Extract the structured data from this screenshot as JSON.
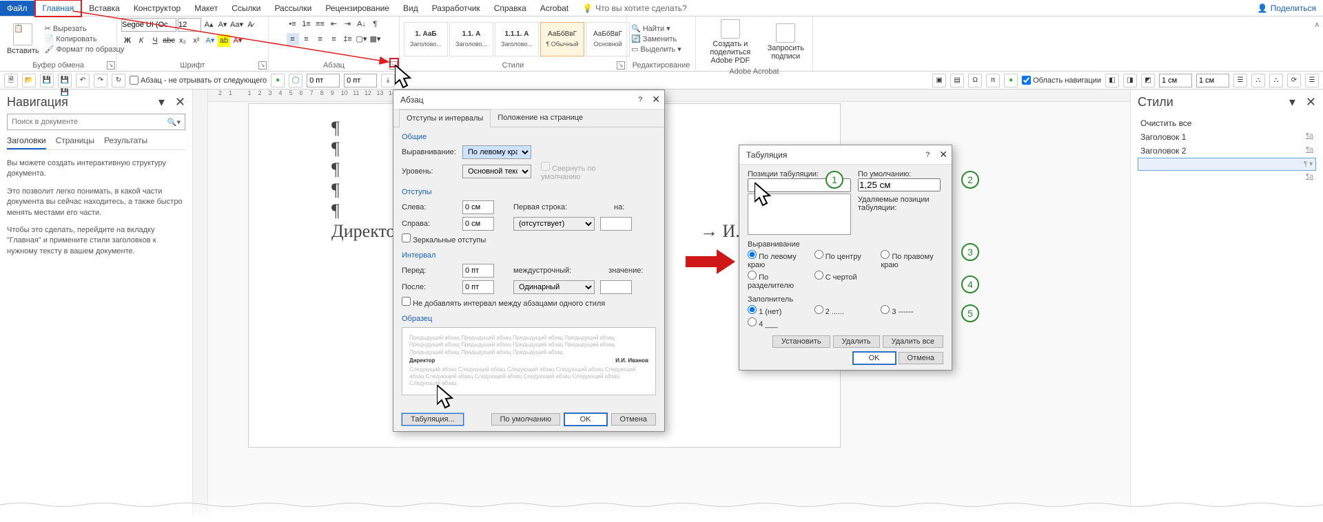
{
  "tabs": {
    "file": "Файл",
    "home": "Главная",
    "insert": "Вставка",
    "design": "Конструктор",
    "layout": "Макет",
    "references": "Ссылки",
    "mailings": "Рассылки",
    "review": "Рецензирование",
    "view": "Вид",
    "developer": "Разработчик",
    "help": "Справка",
    "acrobat": "Acrobat",
    "tellme": "Что вы хотите сделать?",
    "share": "Поделиться"
  },
  "ribbon": {
    "clipboard": {
      "paste": "Вставить",
      "cut": "Вырезать",
      "copy": "Копировать",
      "format_painter": "Формат по образцу",
      "title": "Буфер обмена"
    },
    "font": {
      "name": "Segoe UI (Ос",
      "size": "12",
      "title": "Шрифт"
    },
    "paragraph": {
      "title": "Абзац"
    },
    "styles": {
      "title": "Стили",
      "items": [
        {
          "preview": "1. АаБ",
          "name": "Заголово..."
        },
        {
          "preview": "1.1. А",
          "name": "Заголово..."
        },
        {
          "preview": "1.1.1. А",
          "name": "Заголово..."
        },
        {
          "preview": "АаБбВвГ",
          "name": "¶ Обычный"
        },
        {
          "preview": "АаБбВвГ",
          "name": "Основной"
        }
      ]
    },
    "editing": {
      "find": "Найти",
      "replace": "Заменить",
      "select": "Выделить",
      "title": "Редактирование"
    },
    "acrobat": {
      "create": "Создать и поделиться Adobe PDF",
      "request": "Запросить подписи",
      "title": "Adobe Acrobat"
    }
  },
  "qat": {
    "chk_label": "Абзац - не отрывать от следующего",
    "spinner1": "0 пт",
    "spinner2": "0 пт",
    "navpane": "Область навигации",
    "cm1": "1 см",
    "cm2": "1 см"
  },
  "nav": {
    "title": "Навигация",
    "search_placeholder": "Поиск в документе",
    "tabs": {
      "headings": "Заголовки",
      "pages": "Страницы",
      "results": "Результаты"
    },
    "p1": "Вы можете создать интерактивную структуру документа.",
    "p2": "Это позволит легко понимать, в какой части документа вы сейчас находитесь, а также быстро менять местами его части.",
    "p3": "Чтобы это сделать, перейдите на вкладку \"Главная\" и примените стили заголовков к нужному тексту в вашем документе."
  },
  "doc": {
    "director_line": "Директор →",
    "right_text": "→    И.И."
  },
  "styles_pane": {
    "title": "Стили",
    "clear": "Очистить все",
    "h1": "Заголовок 1",
    "h2": "Заголовок 2"
  },
  "dlg_para": {
    "tab1": "Отступы и интервалы",
    "tab2": "Положение на странице",
    "general": "Общие",
    "alignment_lbl": "Выравнивание:",
    "alignment_val": "По левому краю",
    "level_lbl": "Уровень:",
    "level_val": "Основной текст",
    "collapse": "Свернуть по умолчанию",
    "indents": "Отступы",
    "left_lbl": "Слева:",
    "left_val": "0 см",
    "right_lbl": "Справа:",
    "right_val": "0 см",
    "first_lbl": "Первая строка:",
    "first_val": "(отсутствует)",
    "on_lbl": "на:",
    "mirror": "Зеркальные отступы",
    "spacing": "Интервал",
    "before_lbl": "Перед:",
    "before_val": "0 пт",
    "after_lbl": "После:",
    "after_val": "0 пт",
    "line_lbl": "междустрочный:",
    "line_val": "Одинарный",
    "value_lbl": "значение:",
    "nosame": "Не добавлять интервал между абзацами одного стиля",
    "sample": "Образец",
    "sample_prev": "Предыдущий абзац Предыдущий абзац Предыдущий абзац Предыдущий абзац Предыдущий абзац Предыдущий абзац Предыдущий абзац Предыдущий абзац Предыдущий абзац Предыдущий абзац Предыдущий абзац",
    "sample_dir": "Директор",
    "sample_name": "И.И. Иванов",
    "sample_next": "Следующий абзац Следующий абзац Следующий абзац Следующий абзац Следующий абзац Следующий абзац Следующий абзац Следующий абзац Следующий абзац Следующий абзац",
    "tabs_btn": "Табуляция...",
    "default_btn": "По умолчанию",
    "ok": "OK",
    "cancel": "Отмена"
  },
  "dlg_tab": {
    "title": "Табуляция",
    "positions": "Позиции табуляции:",
    "default_lbl": "По умолчанию:",
    "default_val": "1,25 см",
    "to_clear": "Удаляемые позиции табуляции:",
    "alignment": "Выравнивание",
    "left": "По левому краю",
    "center": "По центру",
    "right": "По правому краю",
    "decimal": "По разделителю",
    "bar": "С чертой",
    "leader": "Заполнитель",
    "l1": "1 (нет)",
    "l2": "2 ......",
    "l3": "3 ------",
    "l4": "4 ___",
    "set": "Установить",
    "clear": "Удалить",
    "clear_all": "Удалить все",
    "ok": "OK",
    "cancel": "Отмена"
  }
}
